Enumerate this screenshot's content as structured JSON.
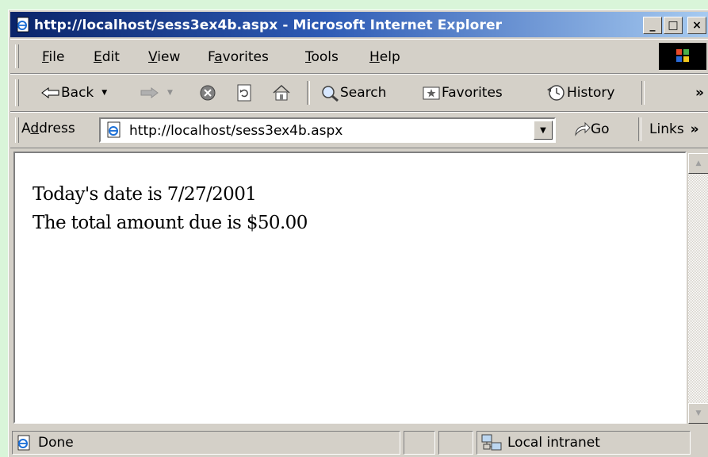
{
  "window": {
    "title": "http://localhost/sess3ex4b.aspx - Microsoft Internet Explorer",
    "controls": {
      "minimize": "_",
      "maximize": "□",
      "close": "×"
    }
  },
  "menu": {
    "items": [
      {
        "label": "File",
        "key": "F",
        "rest": "ile"
      },
      {
        "label": "Edit",
        "key": "E",
        "rest": "dit"
      },
      {
        "label": "View",
        "key": "V",
        "rest": "iew"
      },
      {
        "label": "Favorites",
        "pre": "F",
        "key": "a",
        "rest": "vorites"
      },
      {
        "label": "Tools",
        "key": "T",
        "rest": "ools"
      },
      {
        "label": "Help",
        "key": "H",
        "rest": "elp"
      }
    ]
  },
  "toolbar": {
    "back": "Back",
    "search": "Search",
    "favorites": "Favorites",
    "history": "History",
    "overflow": "»"
  },
  "address": {
    "label_pre": "A",
    "label_key": "d",
    "label_rest": "dress",
    "url": "http://localhost/sess3ex4b.aspx",
    "go": "Go",
    "links": "Links",
    "links_overflow": "»"
  },
  "page": {
    "lines": [
      "Today's date is 7/27/2001",
      "The total amount due is $50.00"
    ]
  },
  "status": {
    "text": "Done",
    "zone": "Local intranet"
  },
  "colors": {
    "title_start": "#0a246a",
    "title_end": "#a6caf0",
    "chrome": "#d4d0c8",
    "backdrop": "#d9f5d9"
  }
}
